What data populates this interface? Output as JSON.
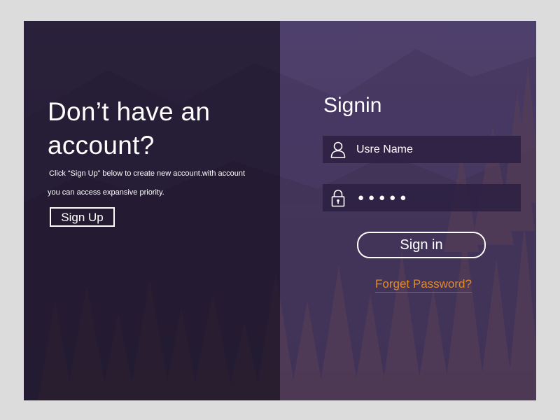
{
  "left_panel": {
    "heading": "Don’t have an account?",
    "description_line1": "Click “Sign Up”  below to create new account.with  account",
    "description_line2": "you can access expansive priority.",
    "signup_label": "Sign Up"
  },
  "right_panel": {
    "title": "Signin",
    "username": {
      "placeholder": "Usre Name",
      "icon": "user-icon"
    },
    "password": {
      "value": "●●●●●",
      "icon": "lock-icon"
    },
    "signin_label": "Sign in",
    "forgot_label": "Forget Password?"
  },
  "colors": {
    "left_overlay": "#1c162c",
    "right_overlay": "#584682",
    "field_bg": "#2e2142",
    "accent_link": "#e08a2e",
    "text": "#ffffff"
  }
}
